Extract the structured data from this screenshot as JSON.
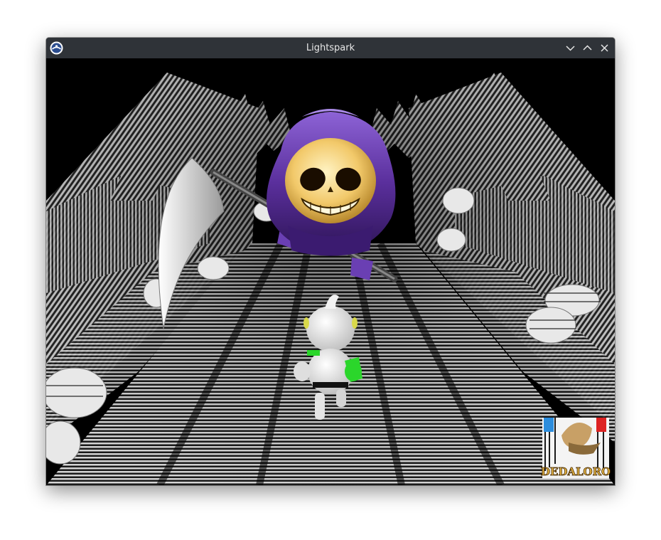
{
  "window": {
    "title": "Lightspark"
  },
  "titlebar": {
    "app_icon": "lightspark-logo-icon",
    "buttons": [
      {
        "name": "minimize",
        "icon": "chevron-down-icon"
      },
      {
        "name": "maximize",
        "icon": "chevron-up-icon"
      },
      {
        "name": "close",
        "icon": "close-icon"
      }
    ]
  },
  "game": {
    "scene": "reaper chasing white character down a striped tunnel",
    "logo_text": "DEDALORO",
    "colors": {
      "titlebar": "#2f3338",
      "robe": "#5b2e9e",
      "skull": "#f3d07a",
      "accent_green": "#2bd62b"
    }
  }
}
